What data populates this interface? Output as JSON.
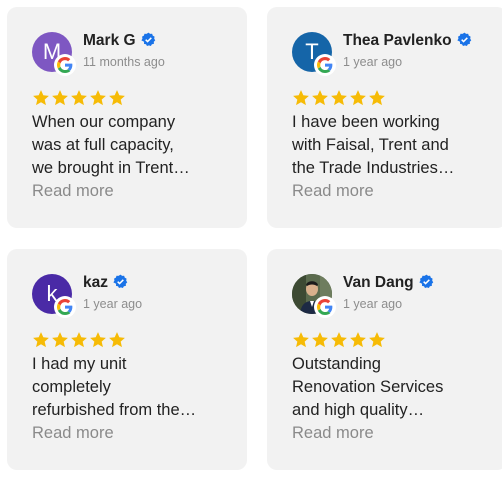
{
  "reviews": [
    {
      "name": "Mark G",
      "initial": "M",
      "avatar_color": "#7e57c2",
      "time": "11 months ago",
      "rating": 5,
      "lines": [
        "When our company",
        "was at full capacity,",
        "we brought in Trent…"
      ],
      "read_more": "Read more"
    },
    {
      "name": "Thea Pavlenko",
      "initial": "T",
      "avatar_color": "#1565a8",
      "time": "1 year ago",
      "rating": 5,
      "lines": [
        "I have been working",
        "with Faisal, Trent and",
        "the Trade Industries…"
      ],
      "read_more": "Read more"
    },
    {
      "name": "kaz",
      "initial": "k",
      "avatar_color": "#4a2aa6",
      "time": "1 year ago",
      "rating": 5,
      "lines": [
        "I had my unit",
        "completely",
        "refurbished from the…"
      ],
      "read_more": "Read more"
    },
    {
      "name": "Van Dang",
      "initial": "",
      "avatar_color": "#3e4a3a",
      "time": "1 year ago",
      "rating": 5,
      "lines": [
        "Outstanding",
        "Renovation Services",
        "and high quality…"
      ],
      "read_more": "Read more"
    }
  ],
  "colors": {
    "star": "#f6bb06",
    "verified": "#1a73e8",
    "card_bg": "#f2f2f2"
  },
  "icons": {
    "source": "google-icon",
    "verified": "verified-badge-icon",
    "star": "star-icon"
  }
}
